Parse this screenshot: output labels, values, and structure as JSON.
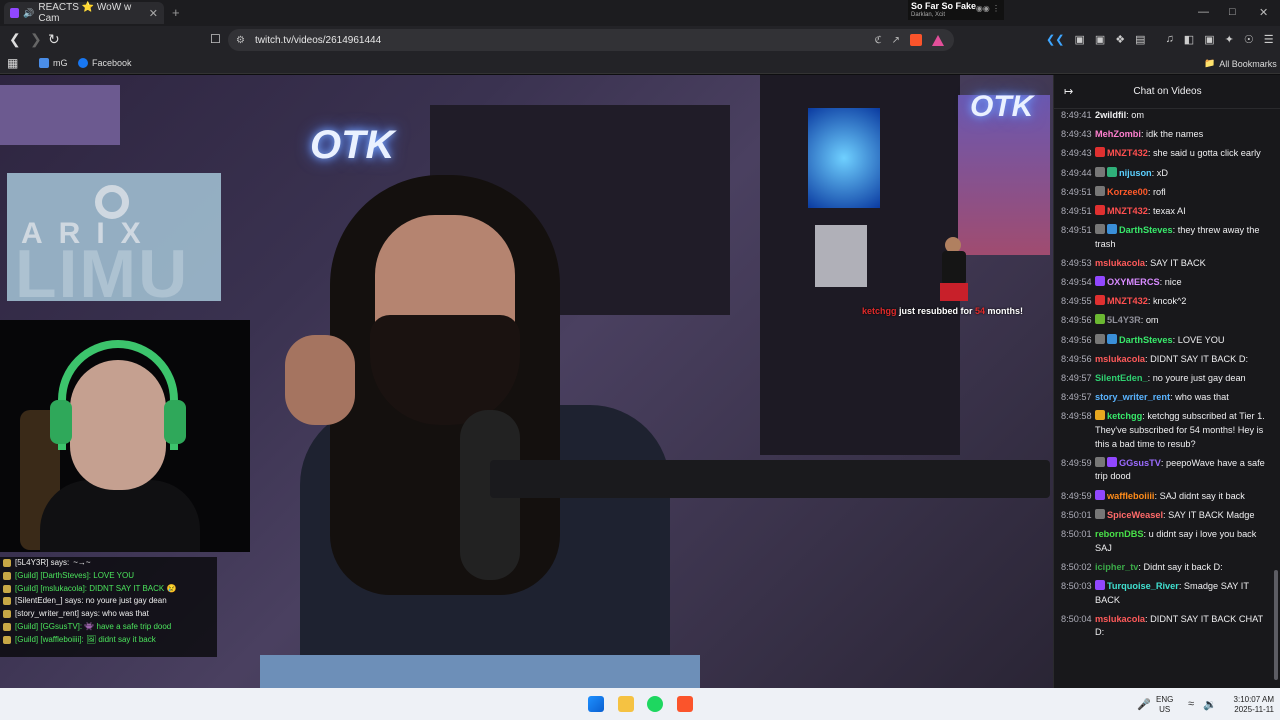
{
  "browser": {
    "tab_title": "REACTS ⭐ WoW w Cam",
    "tab_close": "✕",
    "new_tab": "+",
    "url": "twitch.tv/videos/2614961444",
    "media": {
      "title": "So Far So Fake",
      "artist": "Darklan, Xcit"
    },
    "bookmarks": [
      {
        "label": "mG",
        "color": "#4a8de8"
      },
      {
        "label": "Facebook",
        "color": "#1877f2"
      }
    ],
    "all_bookmarks": "All Bookmarks"
  },
  "stream": {
    "resub_user": "ketchgg",
    "resub_mid": " just resubbed for ",
    "resub_months": "54",
    "resub_end": " months!",
    "overlay_sponsor_top": "ARIX",
    "overlay_sponsor_big": "LIMU",
    "logo": "OTK",
    "game_chat": [
      {
        "guild": false,
        "text": "[5L4Y3R] says: ",
        "extra": "~→~"
      },
      {
        "guild": true,
        "text": "[Guild] [DarthSteves]: LOVE YOU"
      },
      {
        "guild": true,
        "text": "[Guild] [mslukacola]: DIDNT SAY IT BACK 😢"
      },
      {
        "guild": false,
        "text": "[SilentEden_] says: no youre just gay dean"
      },
      {
        "guild": false,
        "text": "[story_writer_rent] says: who was that"
      },
      {
        "guild": true,
        "text": "[Guild] [GGsusTV]: 👾 have a safe trip dood"
      },
      {
        "guild": true,
        "text": "[Guild] [waffleboiiii]: 🖼 didnt say it back"
      }
    ]
  },
  "chat": {
    "title": "Chat on Videos",
    "messages": [
      {
        "ts": "8:49:41",
        "user": "2wildfil",
        "color": "#efeff1",
        "badges": [],
        "text": ": om"
      },
      {
        "ts": "8:49:43",
        "user": "MehZombi",
        "color": "#ff7fcf",
        "badges": [],
        "text": ": idk the names"
      },
      {
        "ts": "8:49:43",
        "user": "MNZT432",
        "color": "#ff4f4f",
        "badges": [
          "#e03030"
        ],
        "text": ": she said u gotta click early"
      },
      {
        "ts": "8:49:44",
        "user": "nijuson",
        "color": "#5bd0ff",
        "badges": [
          "#777",
          "#2fb07a"
        ],
        "text": ": xD"
      },
      {
        "ts": "8:49:51",
        "user": "Korzee00",
        "color": "#ff5a2a",
        "badges": [
          "#777"
        ],
        "text": ": rofl"
      },
      {
        "ts": "8:49:51",
        "user": "MNZT432",
        "color": "#ff4f4f",
        "badges": [
          "#e03030"
        ],
        "text": ": texax AI"
      },
      {
        "ts": "8:49:51",
        "user": "DarthSteves",
        "color": "#38e86a",
        "badges": [
          "#777",
          "#3a8fd8"
        ],
        "text": ": they threw away the trash"
      },
      {
        "ts": "8:49:53",
        "user": "mslukacola",
        "color": "#ff5a5a",
        "badges": [],
        "text": ": SAY IT BACK"
      },
      {
        "ts": "8:49:54",
        "user": "OXYMERCS",
        "color": "#d88bff",
        "badges": [
          "#9147ff"
        ],
        "text": ": nice"
      },
      {
        "ts": "8:49:55",
        "user": "MNZT432",
        "color": "#ff4f4f",
        "badges": [
          "#e03030"
        ],
        "text": ": kncok^2"
      },
      {
        "ts": "8:49:56",
        "user": "5L4Y3R",
        "color": "#8f8f99",
        "badges": [
          "#6bb832"
        ],
        "text": ": om"
      },
      {
        "ts": "8:49:56",
        "user": "DarthSteves",
        "color": "#38e86a",
        "badges": [
          "#777",
          "#3a8fd8"
        ],
        "text": ": LOVE YOU"
      },
      {
        "ts": "8:49:56",
        "user": "mslukacola",
        "color": "#ff5a5a",
        "badges": [],
        "text": ": DIDNT SAY IT BACK D:"
      },
      {
        "ts": "8:49:57",
        "user": "SilentEden_",
        "color": "#2fd070",
        "badges": [],
        "text": ": no youre just gay dean"
      },
      {
        "ts": "8:49:57",
        "user": "story_writer_rent",
        "color": "#5ab4ff",
        "badges": [],
        "text": ": who was that"
      },
      {
        "ts": "8:49:58",
        "user": "ketchgg",
        "color": "#38e86a",
        "badges": [
          "#e8a820"
        ],
        "text": ": ketchgg subscribed at Tier 1. They've subscribed for 54 months! Hey is this a bad time to resub?"
      },
      {
        "ts": "8:49:59",
        "user": "GGsusTV",
        "color": "#9b6bff",
        "badges": [
          "#777",
          "#9147ff"
        ],
        "text": ": peepoWave have a safe trip dood"
      },
      {
        "ts": "8:49:59",
        "user": "waffleboiiii",
        "color": "#ff8c1a",
        "badges": [
          "#9147ff"
        ],
        "text": ": SAJ didnt say it back"
      },
      {
        "ts": "8:50:01",
        "user": "SpiceWeasel",
        "color": "#ff6a6a",
        "badges": [
          "#777"
        ],
        "text": ": SAY IT BACK Madge"
      },
      {
        "ts": "8:50:01",
        "user": "rebornDBS",
        "color": "#48e048",
        "badges": [],
        "text": ": u didnt say i love you back SAJ"
      },
      {
        "ts": "8:50:02",
        "user": "icipher_tv",
        "color": "#3aa848",
        "badges": [],
        "text": ": Didnt say it back D:"
      },
      {
        "ts": "8:50:03",
        "user": "Turquoise_River",
        "color": "#40e0d0",
        "badges": [
          "#9147ff"
        ],
        "text": ": Smadge SAY IT BACK"
      },
      {
        "ts": "8:50:04",
        "user": "mslukacola",
        "color": "#ff5a5a",
        "badges": [],
        "text": ": DIDNT SAY IT BACK CHAT D:"
      }
    ]
  },
  "taskbar": {
    "lang_top": "ENG",
    "lang_bottom": "US",
    "time": "3:10:07 AM",
    "date": "2025-11-11"
  }
}
